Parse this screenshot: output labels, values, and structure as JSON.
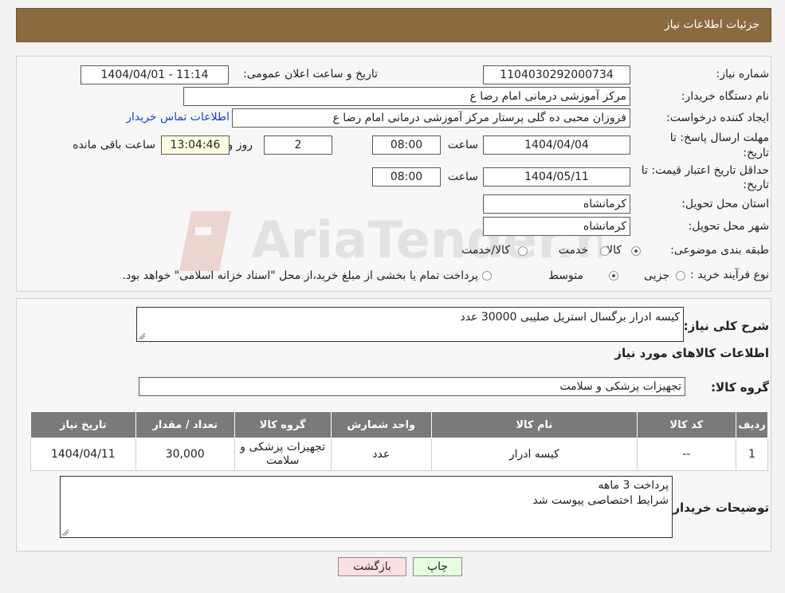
{
  "header": {
    "title": "جزئیات اطلاعات نیاز"
  },
  "form": {
    "need_number_label": "شماره نیاز:",
    "need_number": "1104030292000734",
    "announce_label": "تاریخ و ساعت اعلان عمومی:",
    "announce_value": "1404/04/01 - 11:14",
    "buyer_org_label": "نام دستگاه خریدار:",
    "buyer_org": "مرکز آموزشی  درمانی امام رضا  ع",
    "creator_label": "ایجاد کننده درخواست:",
    "creator": "فروزان محبی ده گلی پرستار مرکز آموزشی  درمانی امام رضا  ع",
    "contact_link": "اطلاعات تماس خریدار",
    "deadline_label_1": "مهلت ارسال پاسخ: تا",
    "deadline_label_2": "تاریخ:",
    "deadline_date": "1404/04/04",
    "time_label": "ساعت",
    "deadline_time": "08:00",
    "days": "2",
    "days_label": "روز و",
    "remaining_time": "13:04:46",
    "remaining_label": "ساعت باقی مانده",
    "validity_label_1": "حداقل تاریخ اعتبار قیمت: تا",
    "validity_label_2": "تاریخ:",
    "validity_date": "1404/05/11",
    "validity_time": "08:00",
    "province_label": "استان محل تحویل:",
    "province": "کرمانشاه",
    "city_label": "شهر محل تحویل:",
    "city": "کرمانشاه",
    "category_label": "طبقه بندی موضوعی:",
    "category_options": [
      "کالا",
      "خدمت",
      "کالا/خدمت"
    ],
    "category_selected": 0,
    "process_label": "نوع فرآیند خرید :",
    "process_options": [
      "جزیی",
      "متوسط"
    ],
    "process_selected": 1,
    "process_note": "پرداخت تمام یا بخشی از مبلغ خرید،از محل \"اسناد خزانه اسلامی\" خواهد بود."
  },
  "details": {
    "summary_label": "شرح کلی نیاز:",
    "summary": "کیسه ادرار برگسال استریل صلیبی   30000 عدد",
    "items_title": "اطلاعات کالاهای مورد نیاز",
    "group_label": "گروه کالا:",
    "group": "تجهیزات پزشکی و سلامت",
    "table": {
      "headers": [
        "ردیف",
        "کد کالا",
        "نام کالا",
        "واحد شمارش",
        "گروه کالا",
        "تعداد / مقدار",
        "تاریخ نیاز"
      ],
      "rows": [
        [
          "1",
          "--",
          "کیسه ادرار",
          "عدد",
          "تجهیزات پزشکی و سلامت",
          "30,000",
          "1404/04/11"
        ]
      ]
    },
    "buyer_notes_label": "توضیحات خریدار:",
    "buyer_notes_line1": "پرداخت 3 ماهه",
    "buyer_notes_line2": "شرایط اختصاصی پیوست شد"
  },
  "buttons": {
    "print": "چاپ",
    "back": "بازگشت"
  },
  "watermark": {
    "text": "AriaTender.neT"
  },
  "colors": {
    "header": "#8c6a3f",
    "link": "#1a44c0",
    "time_bg": "#ffffe0",
    "back_bg": "#ffe0e0",
    "print_bg": "#e6ffe0"
  }
}
